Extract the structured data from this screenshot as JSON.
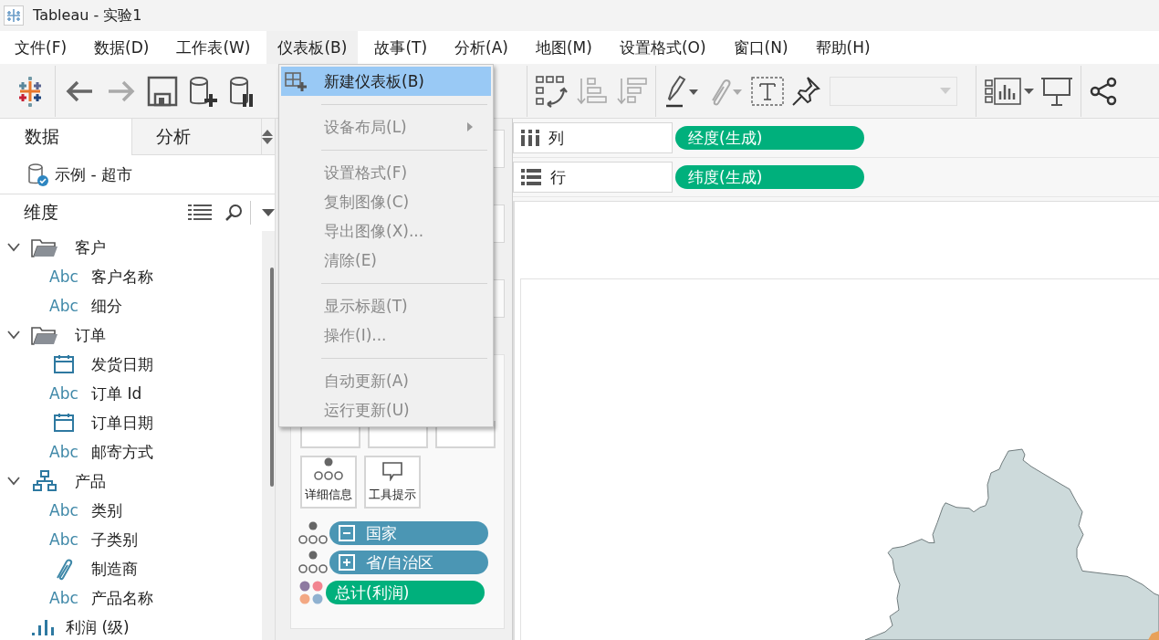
{
  "window": {
    "title": "Tableau - 实验1"
  },
  "menu_bar": [
    {
      "label": "文件(F)",
      "selected": false
    },
    {
      "label": "数据(D)",
      "selected": false
    },
    {
      "label": "工作表(W)",
      "selected": false
    },
    {
      "label": "仪表板(B)",
      "selected": true
    },
    {
      "label": "故事(T)",
      "selected": false
    },
    {
      "label": "分析(A)",
      "selected": false
    },
    {
      "label": "地图(M)",
      "selected": false
    },
    {
      "label": "设置格式(O)",
      "selected": false
    },
    {
      "label": "窗口(N)",
      "selected": false
    },
    {
      "label": "帮助(H)",
      "selected": false
    }
  ],
  "data_pane": {
    "tabs": [
      {
        "label": "数据",
        "selected": true
      },
      {
        "label": "分析",
        "selected": false
      }
    ],
    "data_source": "示例 - 超市",
    "section": "维度",
    "fields": [
      {
        "kind": "folder",
        "label": "客户",
        "expanded": true,
        "children": [
          {
            "kind": "string",
            "type_text": "Abc",
            "label": "客户名称"
          },
          {
            "kind": "string",
            "type_text": "Abc",
            "label": "细分"
          }
        ]
      },
      {
        "kind": "folder",
        "label": "订单",
        "expanded": true,
        "children": [
          {
            "kind": "date",
            "label": "发货日期"
          },
          {
            "kind": "string",
            "type_text": "Abc",
            "label": "订单 Id"
          },
          {
            "kind": "date",
            "label": "订单日期"
          },
          {
            "kind": "string",
            "type_text": "Abc",
            "label": "邮寄方式"
          }
        ]
      },
      {
        "kind": "hierarchy",
        "label": "产品",
        "expanded": true,
        "children": [
          {
            "kind": "string",
            "type_text": "Abc",
            "label": "类别"
          },
          {
            "kind": "string",
            "type_text": "Abc",
            "label": "子类别"
          },
          {
            "kind": "attachment",
            "label": "制造商"
          },
          {
            "kind": "string",
            "type_text": "Abc",
            "label": "产品名称"
          }
        ]
      },
      {
        "kind": "bin",
        "label": "利润 (级)"
      }
    ]
  },
  "shelves": [
    {
      "kind": "columns",
      "label": "列",
      "pill": "经度(生成)"
    },
    {
      "kind": "rows",
      "label": "行",
      "pill": "纬度(生成)"
    }
  ],
  "marks": {
    "buttons": [
      {
        "kind": "detail",
        "label": "详细信息"
      },
      {
        "kind": "tooltip",
        "label": "工具提示"
      }
    ],
    "pills": [
      {
        "kind": "detail",
        "label": "国家",
        "expanded": true,
        "color": "#4b96b4"
      },
      {
        "kind": "detail",
        "label": "省/自治区",
        "expanded": false,
        "color": "#4b96b4"
      },
      {
        "kind": "color",
        "label": "总计(利润)",
        "color": "#00b07c"
      }
    ]
  },
  "dropdown_menu": [
    {
      "kind": "create",
      "label": "新建仪表板(B)",
      "selected": true,
      "disabled": false
    },
    {
      "kind": "separator"
    },
    {
      "kind": "item",
      "label": "设备布局(L)",
      "selected": false,
      "disabled": true,
      "submenu": true
    },
    {
      "kind": "separator"
    },
    {
      "kind": "item",
      "label": "设置格式(F)",
      "selected": false,
      "disabled": true
    },
    {
      "kind": "item",
      "label": "复制图像(C)",
      "selected": false,
      "disabled": true
    },
    {
      "kind": "item",
      "label": "导出图像(X)...",
      "selected": false,
      "disabled": true
    },
    {
      "kind": "item",
      "label": "清除(E)",
      "selected": false,
      "disabled": true
    },
    {
      "kind": "separator"
    },
    {
      "kind": "item",
      "label": "显示标题(T)",
      "selected": false,
      "disabled": true
    },
    {
      "kind": "item",
      "label": "操作(I)...",
      "selected": false,
      "disabled": true
    },
    {
      "kind": "separator"
    },
    {
      "kind": "item",
      "label": "自动更新(A)",
      "selected": false,
      "disabled": true
    },
    {
      "kind": "item",
      "label": "运行更新(U)",
      "selected": false,
      "disabled": true
    }
  ]
}
